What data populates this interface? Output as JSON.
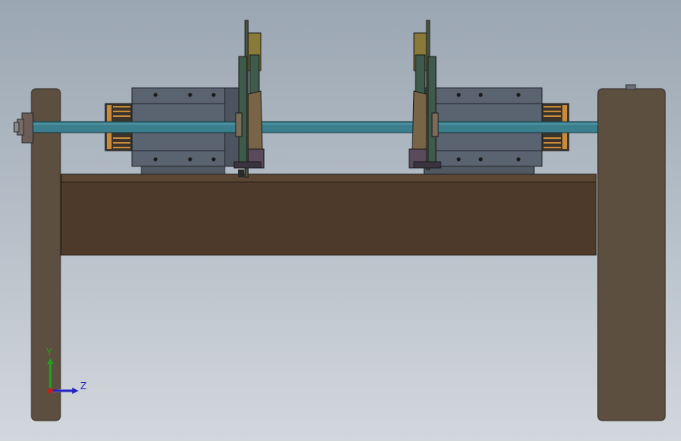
{
  "viewport": {
    "background_top": "#9aa6b2",
    "background_bottom": "#d2d7dc"
  },
  "colors": {
    "frame_brown": "#5c4f40",
    "beam_brown": "#4d3a2a",
    "shaft_teal": "#3b7f8e",
    "housing_gray": "#5a6370",
    "plate_green": "#3e5a4a",
    "clamp_tan": "#8a7a3a",
    "spring_orange": "#c98a3a"
  },
  "triad": {
    "y_label": "Y",
    "z_label": "Z",
    "y_color": "#1fa31f",
    "z_color": "#2323c0",
    "origin_color": "#c01f1f"
  }
}
